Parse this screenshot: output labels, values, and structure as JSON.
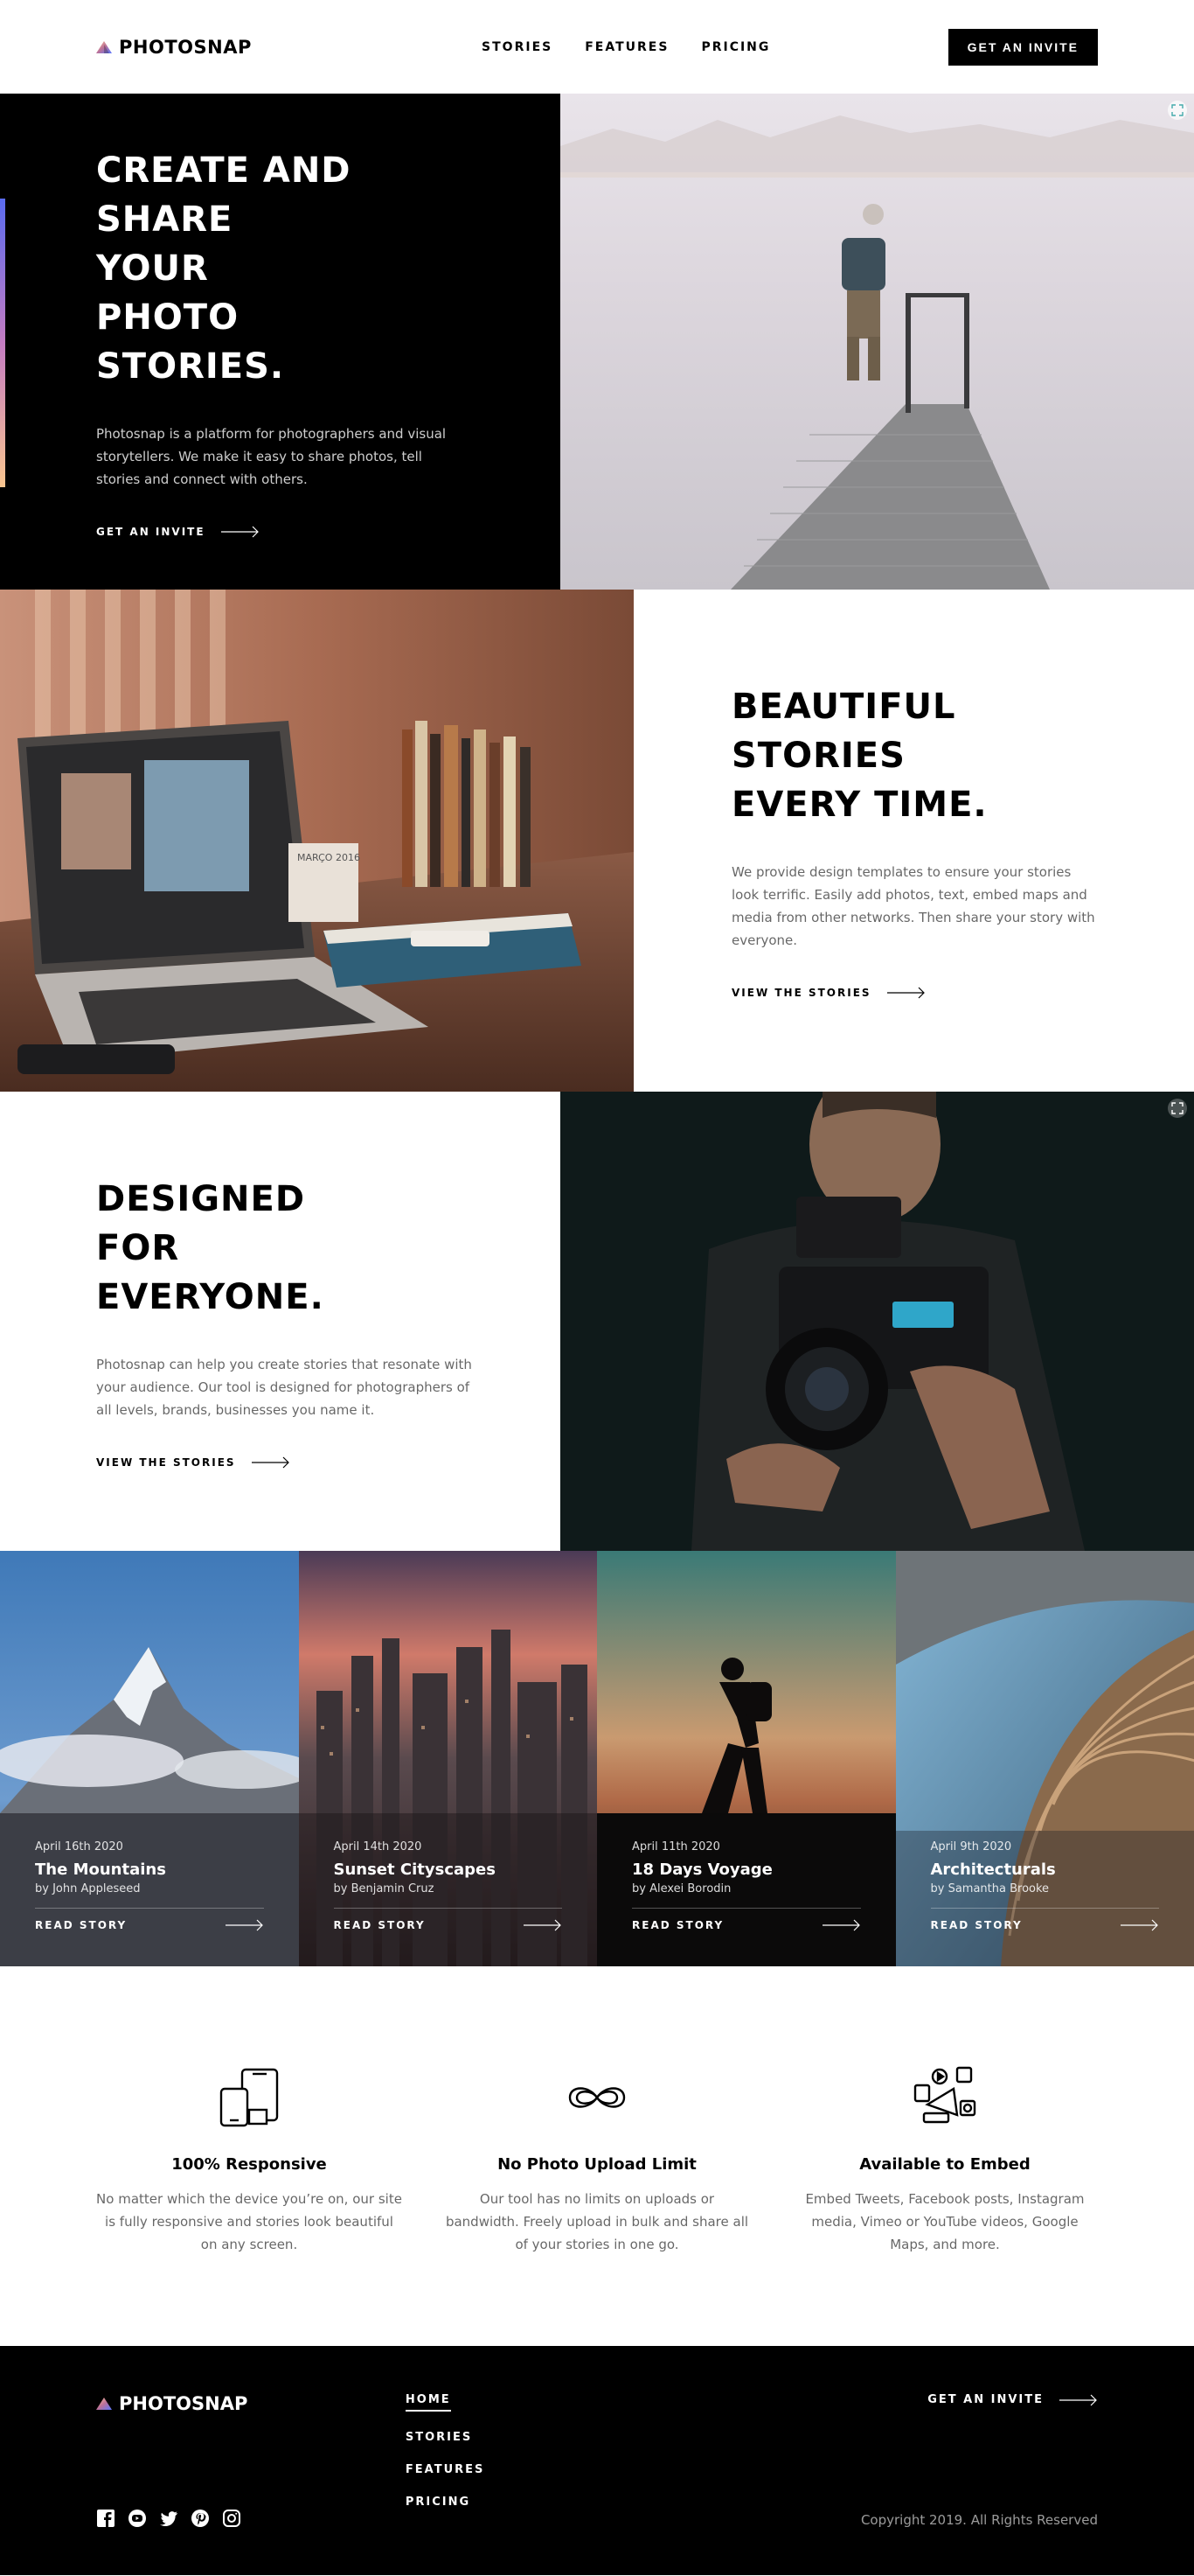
{
  "brand": {
    "name": "PHOTOSNAP",
    "gradient": [
      "#FFC593",
      "#BC7198",
      "#5A77FF"
    ]
  },
  "header": {
    "nav": [
      {
        "label": "STORIES"
      },
      {
        "label": "FEATURES"
      },
      {
        "label": "PRICING"
      }
    ],
    "cta_label": "GET AN INVITE"
  },
  "hero": {
    "title": "CREATE AND SHARE YOUR PHOTO STORIES.",
    "body": "Photosnap is a platform for photographers and visual storytellers. We make it easy to share photos, tell stories and connect with others.",
    "cta": "GET AN INVITE"
  },
  "section_beautiful": {
    "title": "BEAUTIFUL STORIES EVERY TIME.",
    "body": "We provide design templates to ensure your stories look terrific. Easily add photos, text, embed maps and media from other networks. Then share your story with everyone.",
    "cta": "VIEW THE STORIES"
  },
  "section_designed": {
    "title": "DESIGNED FOR EVERYONE.",
    "body": "Photosnap can help you create stories that resonate with your audience. Our tool is designed for photographers of all levels, brands, businesses you name it.",
    "cta": "VIEW THE STORIES"
  },
  "stories": [
    {
      "date": "April 16th 2020",
      "title": "The Mountains",
      "author": "by John Appleseed",
      "cta": "READ STORY"
    },
    {
      "date": "April 14th 2020",
      "title": "Sunset Cityscapes",
      "author": "by Benjamin Cruz",
      "cta": "READ STORY"
    },
    {
      "date": "April 11th 2020",
      "title": "18 Days Voyage",
      "author": "by Alexei Borodin",
      "cta": "READ STORY"
    },
    {
      "date": "April 9th 2020",
      "title": "Architecturals",
      "author": "by Samantha Brooke",
      "cta": "READ STORY"
    }
  ],
  "features": [
    {
      "icon": "responsive-devices-icon",
      "title": "100% Responsive",
      "body": "No matter which the device you’re on, our site is fully responsive and stories look beautiful on any screen."
    },
    {
      "icon": "infinity-icon",
      "title": "No Photo Upload Limit",
      "body": "Our tool has no limits on uploads or bandwidth. Freely upload in bulk and share all of your stories in one go."
    },
    {
      "icon": "embed-media-icon",
      "title": "Available to Embed",
      "body": "Embed Tweets, Facebook posts, Instagram media, Vimeo or YouTube videos, Google Maps, and more."
    }
  ],
  "footer": {
    "nav": [
      {
        "label": "HOME",
        "active": true
      },
      {
        "label": "STORIES"
      },
      {
        "label": "FEATURES"
      },
      {
        "label": "PRICING"
      }
    ],
    "socials": [
      "facebook-icon",
      "youtube-icon",
      "twitter-icon",
      "pinterest-icon",
      "instagram-icon"
    ],
    "cta": "GET AN INVITE",
    "copyright": "Copyright 2019. All Rights Reserved"
  }
}
